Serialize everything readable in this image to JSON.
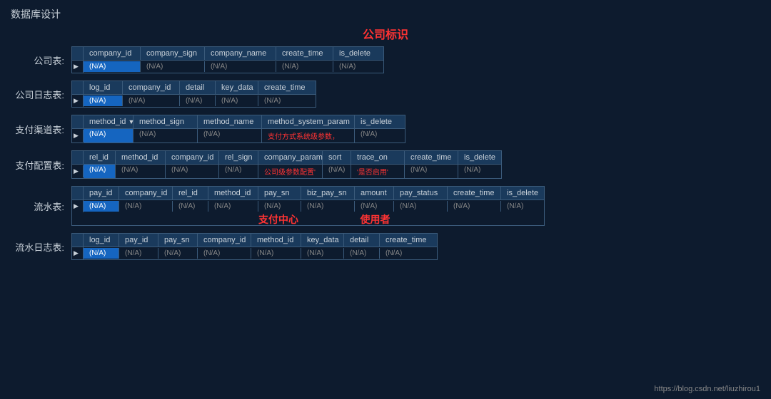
{
  "title": "数据库设计",
  "center_label": "公司标识",
  "footer_link": "https://blog.csdn.net/liuzhirou1",
  "tables": [
    {
      "label": "公司表:",
      "columns": [
        "company_id",
        "company_sign",
        "company_name",
        "create_time",
        "is_delete"
      ],
      "data": [
        "(N/A)",
        "(N/A)",
        "(N/A)",
        "(N/A)",
        "(N/A)"
      ],
      "highlight_col": 0,
      "widths": [
        80,
        90,
        100,
        80,
        70
      ]
    },
    {
      "label": "公司日志表:",
      "columns": [
        "log_id",
        "company_id",
        "detail",
        "key_data",
        "create_time"
      ],
      "data": [
        "(N/A)",
        "(N/A)",
        "(N/A)",
        "(N/A)",
        "(N/A)"
      ],
      "highlight_col": 0,
      "widths": [
        55,
        80,
        50,
        60,
        80
      ]
    },
    {
      "label": "支付渠道表:",
      "columns": [
        "method_id",
        "method_sign",
        "method_name",
        "method_system_param",
        "is_delete"
      ],
      "data": [
        "(N/A)",
        "(N/A)",
        "(N/A)",
        "支付方式系统级参数，",
        "(N/A)"
      ],
      "highlight_col": 0,
      "has_arrow": true,
      "red_col": 3,
      "widths": [
        70,
        90,
        90,
        130,
        70
      ]
    },
    {
      "label": "支付配置表:",
      "columns": [
        "rel_id",
        "method_id",
        "company_id",
        "rel_sign",
        "company_param",
        "sort",
        "trace_on",
        "create_time",
        "is_delete"
      ],
      "data": [
        "(N/A)",
        "(N/A)",
        "(N/A)",
        "(N/A)",
        "公司级参数配置'",
        "(N/A)",
        "'是否启用'",
        "(N/A)",
        "(N/A)"
      ],
      "highlight_col": 0,
      "red_col": 4,
      "red_col2": 6,
      "widths": [
        45,
        70,
        75,
        55,
        90,
        40,
        75,
        75,
        60
      ]
    },
    {
      "label": "流水表:",
      "columns": [
        "pay_id",
        "company_id",
        "rel_id",
        "method_id",
        "pay_sn",
        "biz_pay_sn",
        "amount",
        "pay_status",
        "create_time",
        "is_delete"
      ],
      "data": [
        "(N/A)",
        "(N/A)",
        "(N/A)",
        "(N/A)",
        "(N/A)",
        "(N/A)",
        "(N/A)",
        "(N/A)",
        "(N/A)",
        "(N/A)"
      ],
      "highlight_col": 0,
      "inline_labels": [
        "支付中心",
        "使用者"
      ],
      "inline_label_positions": [
        4,
        6
      ],
      "widths": [
        50,
        75,
        50,
        70,
        60,
        75,
        55,
        75,
        75,
        60
      ]
    },
    {
      "label": "流水日志表:",
      "columns": [
        "log_id",
        "pay_id",
        "pay_sn",
        "company_id",
        "method_id",
        "key_data",
        "detail",
        "create_time"
      ],
      "data": [
        "(N/A)",
        "(N/A)",
        "(N/A)",
        "(N/A)",
        "(N/A)",
        "(N/A)",
        "(N/A)",
        "(N/A)"
      ],
      "highlight_col": 0,
      "widths": [
        50,
        55,
        55,
        75,
        70,
        60,
        50,
        80
      ]
    }
  ]
}
